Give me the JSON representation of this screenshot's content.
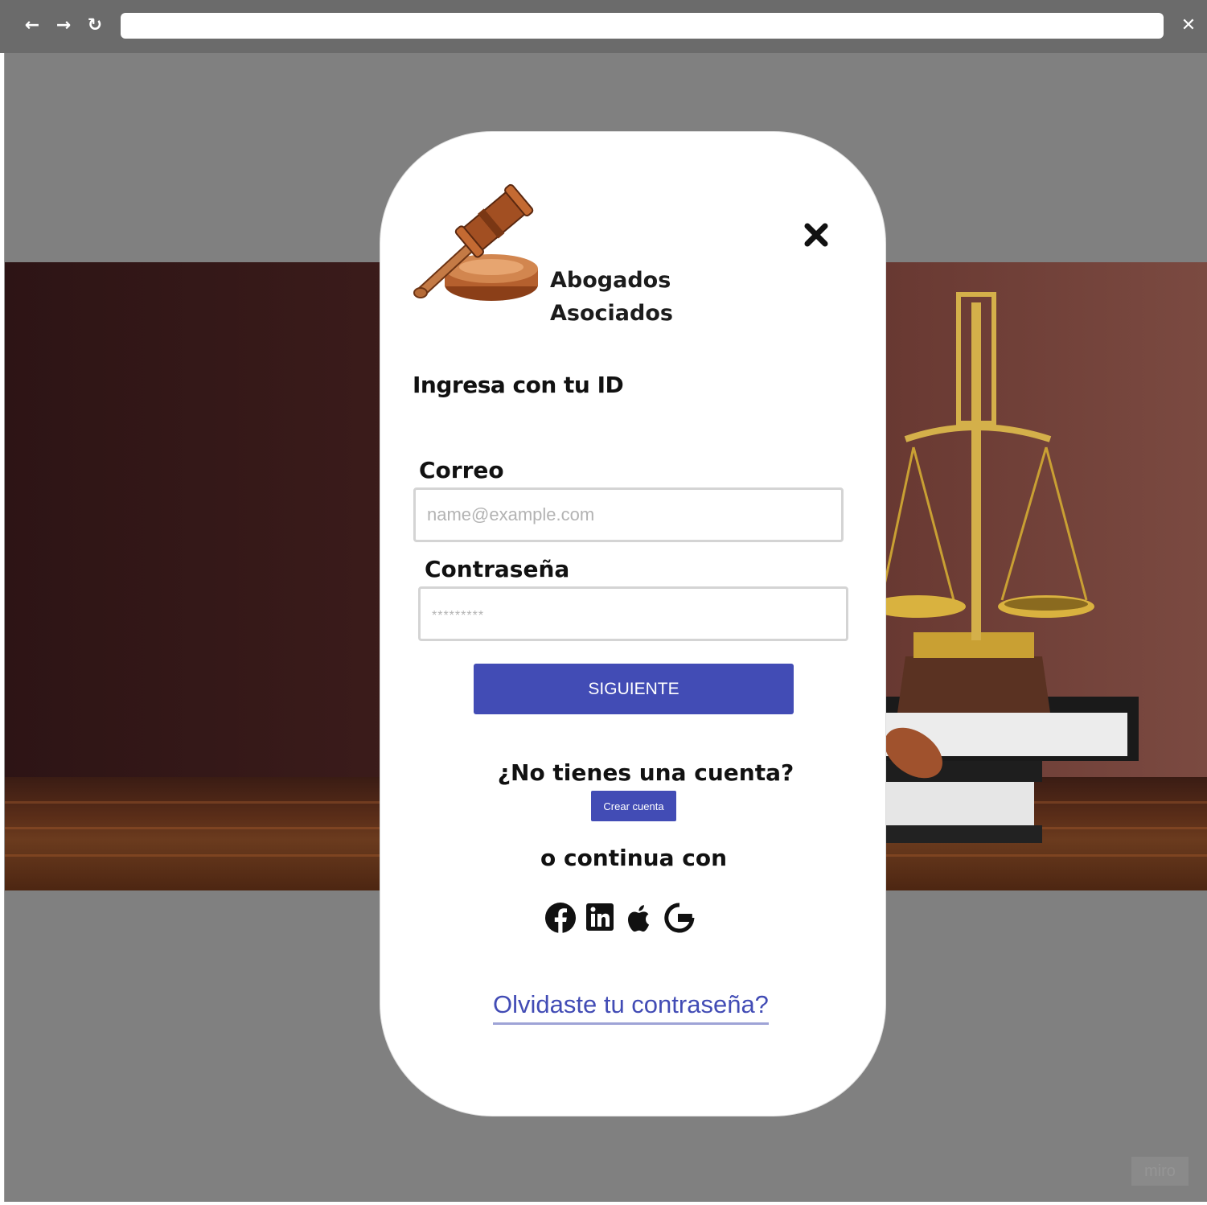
{
  "browser": {
    "back_icon": "←",
    "forward_icon": "→",
    "reload_icon": "↻",
    "close_icon": "✕",
    "address": ""
  },
  "brand": {
    "line1": "Abogados",
    "line2": "Asociados"
  },
  "login": {
    "heading": "Ingresa con tu ID",
    "email_label": "Correo",
    "email_placeholder": "name@example.com",
    "password_label": "Contraseña",
    "password_placeholder": "*********",
    "submit_label": "SIGUIENTE",
    "no_account_text": "¿No tienes una cuenta?",
    "create_account_label": "Crear cuenta",
    "continue_with_text": "o continua con",
    "social": [
      "facebook-icon",
      "linkedin-icon",
      "apple-icon",
      "google-icon"
    ],
    "forgot_password_label": "Olvidaste tu contraseña?"
  },
  "watermark": "miro",
  "colors": {
    "accent": "#424cb5",
    "chrome": "#6b6b6b",
    "backdrop": "#808080"
  }
}
